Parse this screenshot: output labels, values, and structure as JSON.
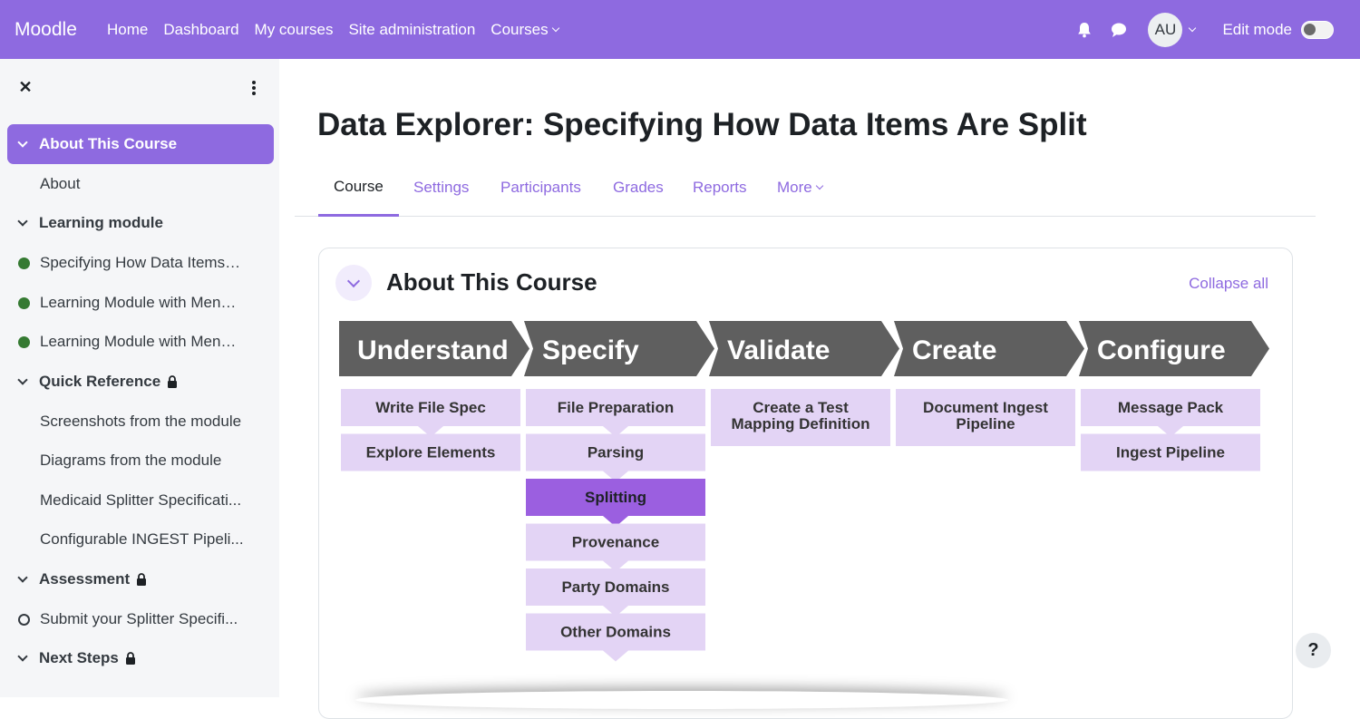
{
  "navbar": {
    "brand": "Moodle",
    "links": [
      "Home",
      "Dashboard",
      "My courses",
      "Site administration",
      "Courses"
    ],
    "avatar": "AU",
    "edit_mode": "Edit mode",
    "edit_mode_on": false,
    "color": "#8e6ae0"
  },
  "course_index": {
    "sections": [
      {
        "title": "About This Course",
        "active": true,
        "items": [
          {
            "label": "About"
          }
        ]
      },
      {
        "title": "Learning module",
        "items": [
          {
            "label": "Specifying How Data Items ...",
            "status": "complete"
          },
          {
            "label": "Learning Module with Menu...",
            "status": "complete"
          },
          {
            "label": "Learning Module with Menu...",
            "status": "complete"
          }
        ]
      },
      {
        "title": "Quick Reference",
        "locked": true,
        "items": [
          {
            "label": "Screenshots from the module"
          },
          {
            "label": "Diagrams from the module"
          },
          {
            "label": "Medicaid Splitter Specificati..."
          },
          {
            "label": "Configurable INGEST Pipeli..."
          }
        ]
      },
      {
        "title": "Assessment",
        "locked": true,
        "items": [
          {
            "label": "Submit your Splitter Specifi...",
            "status": "incomplete"
          }
        ]
      },
      {
        "title": "Next Steps",
        "locked": true,
        "items": []
      }
    ]
  },
  "page": {
    "title": "Data Explorer: Specifying How Data Items Are Split",
    "tabs": [
      "Course",
      "Settings",
      "Participants",
      "Grades",
      "Reports",
      "More"
    ],
    "active_tab": "Course"
  },
  "section": {
    "title": "About This Course",
    "collapse_all": "Collapse all"
  },
  "diagram": {
    "stages": [
      {
        "label": "Understand",
        "steps": [
          "Write File Spec",
          "Explore Elements"
        ]
      },
      {
        "label": "Specify",
        "steps": [
          "File Preparation",
          "Parsing",
          "Splitting",
          "Provenance",
          "Party Domains",
          "Other Domains"
        ],
        "highlight": "Splitting"
      },
      {
        "label": "Validate",
        "steps": [
          "Create a Test\nMapping Definition"
        ]
      },
      {
        "label": "Create",
        "steps": [
          "Document Ingest\nPipeline"
        ]
      },
      {
        "label": "Configure",
        "steps": [
          "Message Pack",
          "Ingest Pipeline"
        ]
      }
    ],
    "colors": {
      "header": "#5f5f5f",
      "step": "#e3d4f5",
      "highlight": "#9b5fe0"
    }
  },
  "help": "?"
}
